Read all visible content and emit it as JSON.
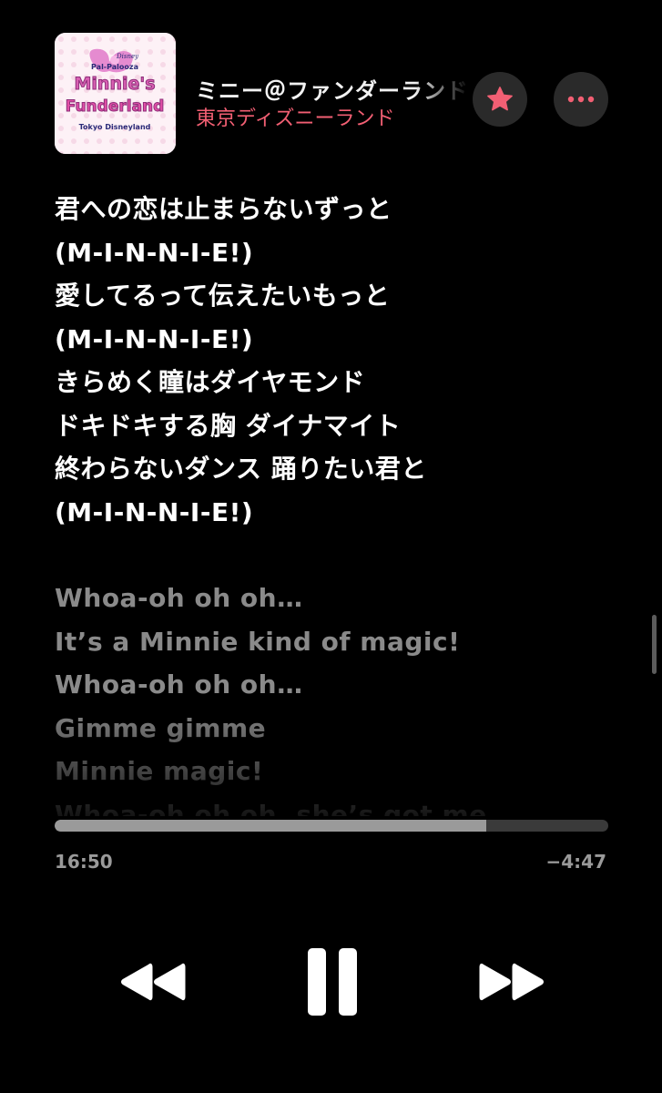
{
  "now_playing": {
    "title": "ミニー＠ファンダーランド",
    "artist": "東京ディズニーランド",
    "artwork": {
      "lines": [
        "Disney",
        "Pal-Palooza",
        "Minnie's",
        "Funderland",
        "Tokyo Disneyland"
      ]
    }
  },
  "lyrics": {
    "lines": [
      {
        "text": "君への恋は止まらないずっと",
        "state": "active"
      },
      {
        "text": "(M-I-N-N-I-E!)",
        "state": "active"
      },
      {
        "text": "愛してるって伝えたいもっと",
        "state": "active"
      },
      {
        "text": "(M-I-N-N-I-E!)",
        "state": "active"
      },
      {
        "text": "きらめく瞳はダイヤモンド",
        "state": "active"
      },
      {
        "text": "ドキドキする胸 ダイナマイト",
        "state": "active"
      },
      {
        "text": "終わらないダンス 踊りたい君と",
        "state": "active"
      },
      {
        "text": "(M-I-N-N-I-E!)",
        "state": "active"
      },
      {
        "text": "",
        "state": "spacer"
      },
      {
        "text": "Whoa-oh oh oh…",
        "state": "upcoming"
      },
      {
        "text": "It’s a Minnie kind of magic!",
        "state": "upcoming"
      },
      {
        "text": "Whoa-oh oh oh…",
        "state": "upcoming"
      },
      {
        "text": "Gimme gimme",
        "state": "upcoming"
      },
      {
        "text": "Minnie magic!",
        "state": "upcoming"
      },
      {
        "text": "Whoa-oh oh oh, she’s got me",
        "state": "upcoming"
      }
    ]
  },
  "playback": {
    "elapsed": "16:50",
    "remaining": "−4:47",
    "progress": 0.78
  },
  "icons": {
    "favorite": "star-icon",
    "more": "ellipsis-icon",
    "previous": "rewind-icon",
    "play_pause": "pause-icon",
    "next": "fast-forward-icon"
  },
  "colors": {
    "background": "#000000",
    "accent": "#f25f73",
    "button_bg": "#2a2a2a",
    "secondary_text": "#9a9a9a"
  }
}
